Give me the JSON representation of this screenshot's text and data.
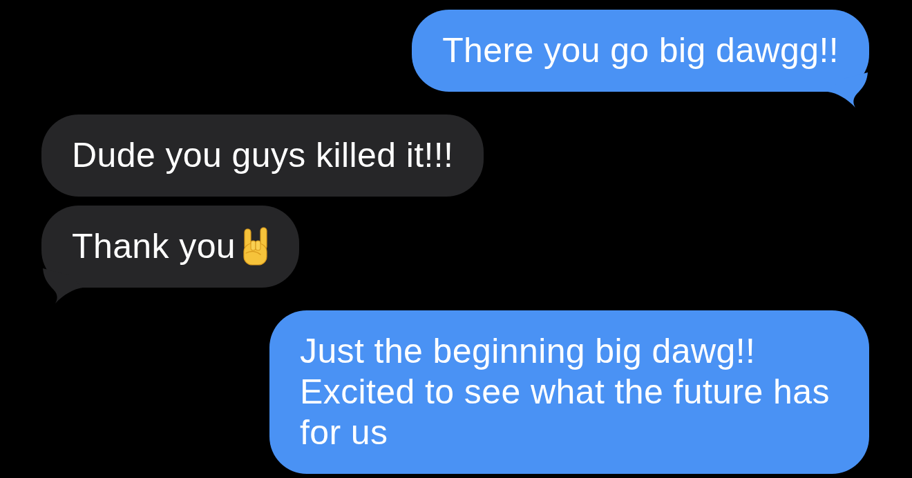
{
  "messages": [
    {
      "kind": "sent",
      "text": "There you go big dawgg!!",
      "tail": true,
      "emoji": false
    },
    {
      "kind": "received",
      "text": "Dude you guys killed it!!!",
      "tail": false,
      "emoji": false
    },
    {
      "kind": "received",
      "text": "Thank you",
      "tail": true,
      "emoji": true
    },
    {
      "kind": "sent",
      "text": "Just the beginning big dawg!! Excited to see what the future has for us",
      "tail": false,
      "emoji": false
    }
  ]
}
